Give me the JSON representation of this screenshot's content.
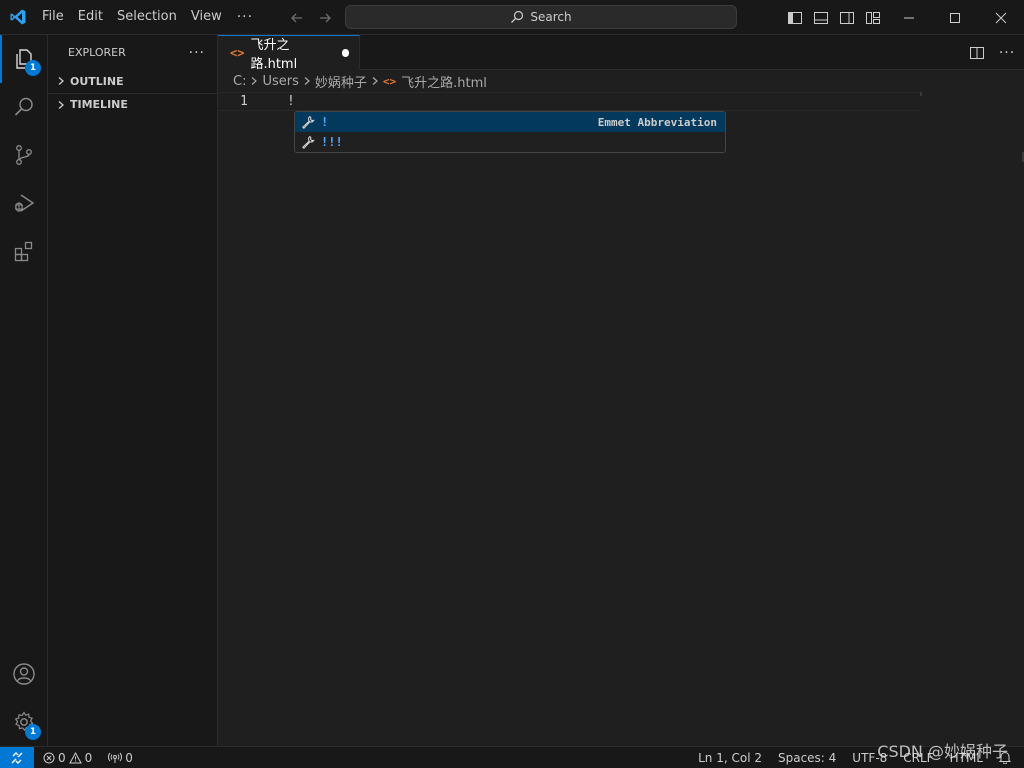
{
  "menu": {
    "items": [
      "File",
      "Edit",
      "Selection",
      "View"
    ],
    "more": "···"
  },
  "search": {
    "label": "Search"
  },
  "activity": {
    "explorer_badge": "1",
    "settings_badge": "1"
  },
  "sidebar": {
    "title": "EXPLORER",
    "more": "···",
    "sections": [
      "OUTLINE",
      "TIMELINE"
    ]
  },
  "editor": {
    "tab": {
      "label": "飞升之路.html",
      "icon": "<>"
    },
    "tab_more": "···",
    "breadcrumbs": [
      "C:",
      "Users",
      "妙娲种子",
      "飞升之路.html"
    ],
    "line_number": "1",
    "code": "!",
    "suggestions": [
      {
        "label": "!",
        "detail": "Emmet Abbreviation"
      },
      {
        "label": "!!!",
        "detail": ""
      }
    ]
  },
  "statusbar": {
    "errors": "0",
    "warnings": "0",
    "ports": "0",
    "position": "Ln 1, Col 2",
    "spaces": "Spaces: 4",
    "encoding": "UTF-8",
    "eol": "CRLF",
    "language": "HTML"
  },
  "watermark": "CSDN @妙娲种子",
  "colors": {
    "accent": "#0078d4",
    "file_icon": "#e37933",
    "suggest_selected": "#04395e",
    "suggest_text": "#4daafc"
  }
}
